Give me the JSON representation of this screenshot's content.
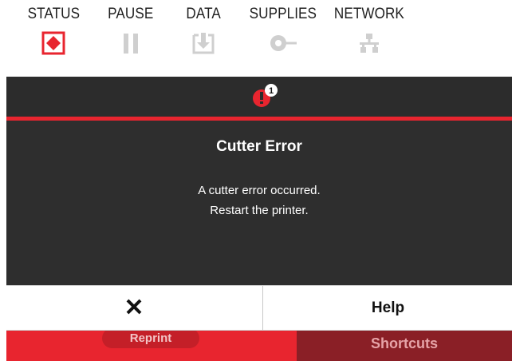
{
  "indicators": [
    {
      "label": "STATUS",
      "icon": "status-diamond-icon",
      "state": "error",
      "color": "#e8252f"
    },
    {
      "label": "PAUSE",
      "icon": "pause-icon",
      "state": "inactive",
      "color": "#cfcfcf"
    },
    {
      "label": "DATA",
      "icon": "data-download-icon",
      "state": "inactive",
      "color": "#cfcfcf"
    },
    {
      "label": "SUPPLIES",
      "icon": "supplies-roll-icon",
      "state": "inactive",
      "color": "#cfcfcf"
    },
    {
      "label": "NETWORK",
      "icon": "network-icon",
      "state": "inactive",
      "color": "#cfcfcf"
    }
  ],
  "alert": {
    "count": "1",
    "icon": "alert-exclamation-icon",
    "color": "#e8252f"
  },
  "dialog": {
    "title": "Cutter Error",
    "message_line1": "A cutter error occurred.",
    "message_line2": "Restart the printer.",
    "close_icon": "close-x-icon",
    "help_label": "Help"
  },
  "background_home": {
    "reprint_label": "Reprint",
    "shortcuts_label": "Shortcuts",
    "shortcuts_icon": "bookmark-icon"
  },
  "colors": {
    "accent": "#e8252f",
    "screen_bg": "#2e2e2e",
    "shortcuts_bg": "#8a1f26"
  }
}
